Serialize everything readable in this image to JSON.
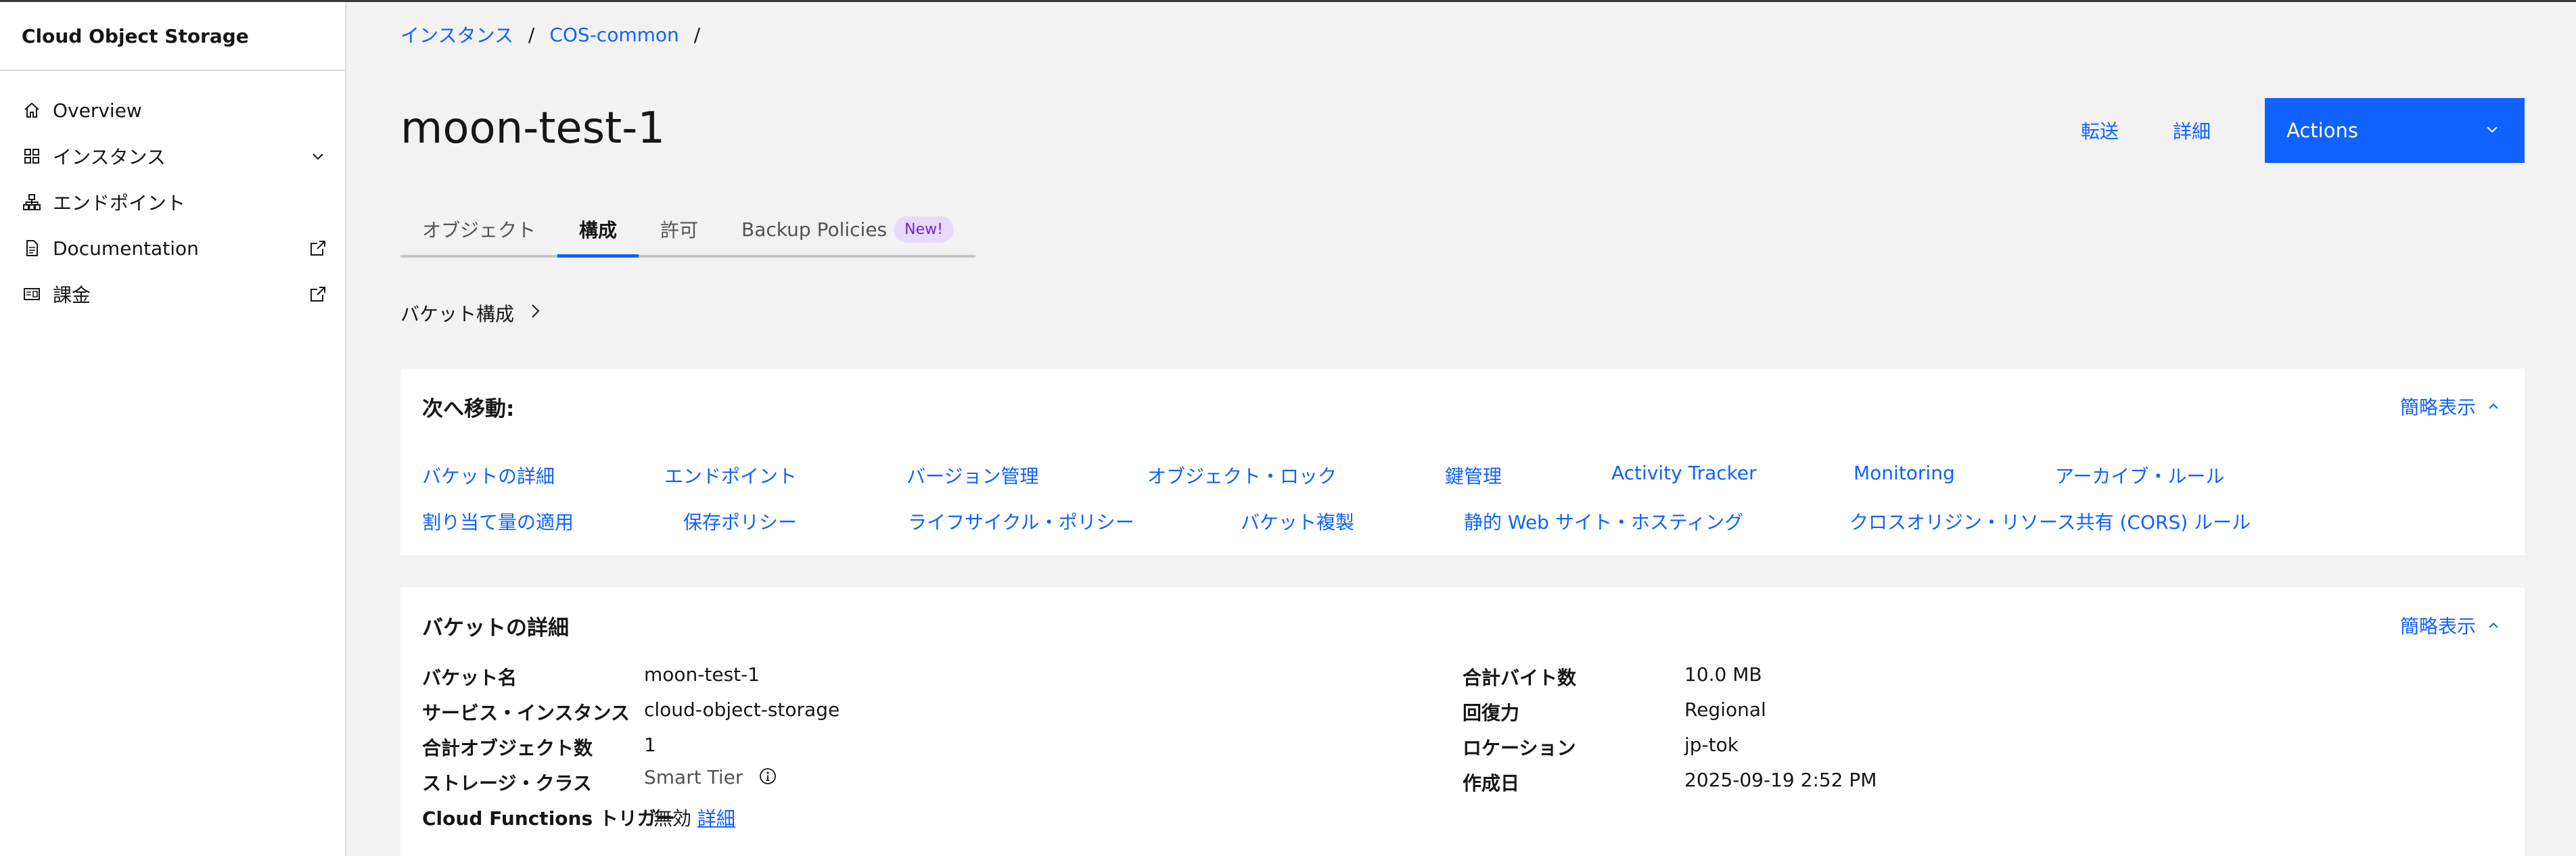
{
  "sidebar": {
    "title": "Cloud Object Storage",
    "items": [
      {
        "label": "Overview",
        "icon": "home-icon"
      },
      {
        "label": "インスタンス",
        "icon": "grid-icon",
        "trail": "chevron-down-icon"
      },
      {
        "label": "エンドポイント",
        "icon": "network-icon"
      },
      {
        "label": "Documentation",
        "icon": "document-icon",
        "trail": "external-link-icon"
      },
      {
        "label": "課金",
        "icon": "billing-icon",
        "trail": "external-link-icon"
      }
    ]
  },
  "breadcrumb": {
    "items": [
      "インスタンス",
      "COS-common"
    ],
    "sep": "/"
  },
  "header": {
    "title": "moon-test-1",
    "transfer": "転送",
    "details": "詳細",
    "actions": "Actions"
  },
  "tabs": [
    {
      "label": "オブジェクト"
    },
    {
      "label": "構成"
    },
    {
      "label": "許可"
    },
    {
      "label": "Backup Policies",
      "badge": "New!"
    }
  ],
  "bucket_config": "バケット構成",
  "nav_card": {
    "title": "次へ移動:",
    "collapse": "簡略表示",
    "row1": [
      "バケットの詳細",
      "エンドポイント",
      "バージョン管理",
      "オブジェクト・ロック",
      "鍵管理",
      "Activity Tracker",
      "Monitoring",
      "アーカイブ・ルール"
    ],
    "row2": [
      "割り当て量の適用",
      "保存ポリシー",
      "ライフサイクル・ポリシー",
      "バケット複製",
      "静的 Web サイト・ホスティング",
      "クロスオリジン・リソース共有 (CORS) ルール"
    ]
  },
  "details_card": {
    "title": "バケットの詳細",
    "collapse": "簡略表示",
    "left": [
      {
        "label": "バケット名",
        "value": "moon-test-1"
      },
      {
        "label": "サービス・インスタンス",
        "value": "cloud-object-storage"
      },
      {
        "label": "合計オブジェクト数",
        "value": "1"
      },
      {
        "label": "ストレージ・クラス",
        "value": "Smart Tier"
      }
    ],
    "cloud_functions": {
      "label": "Cloud Functions トリガー",
      "value": "無効",
      "link": "詳細"
    },
    "right": [
      {
        "label": "合計バイト数",
        "value": "10.0 MB"
      },
      {
        "label": "回復力",
        "value": "Regional"
      },
      {
        "label": "ロケーション",
        "value": "jp-tok"
      },
      {
        "label": "作成日",
        "value": "2025-09-19 2:52 PM"
      }
    ]
  },
  "colors": {
    "accent": "#0f62fe",
    "badge_bg": "#e8daff",
    "badge_fg": "#6929c4"
  }
}
